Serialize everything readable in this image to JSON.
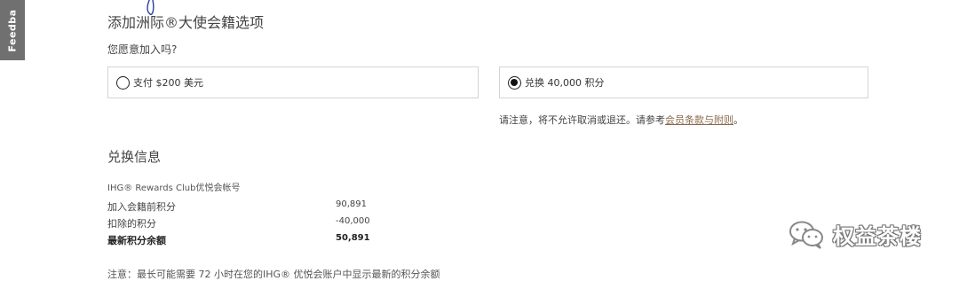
{
  "feedback": {
    "label": "Feedba"
  },
  "section": {
    "title": "添加洲际®大使会籍选项",
    "question": "您愿意加入吗?"
  },
  "options": {
    "pay_label": "支付 $200 美元",
    "redeem_label": "兑换 40,000 积分",
    "selected": "redeem"
  },
  "notice": {
    "text": "请注意，将不允许取消或退还。请参考",
    "link": "会员条款与附则",
    "end": "。"
  },
  "redemption": {
    "title": "兑换信息",
    "account_label": "IHG® Rewards Club优悦会帐号",
    "rows": [
      {
        "label": "加入会籍前积分",
        "value": "90,891"
      },
      {
        "label": "扣除的积分",
        "value": "-40,000"
      },
      {
        "label": "最新积分余额",
        "value": "50,891"
      }
    ]
  },
  "footnote": "注意：最长可能需要 72 小时在您的IHG® 优悦会账户中显示最新的积分余额",
  "watermark": {
    "text": "权益茶楼",
    "icon": "wechat-icon"
  }
}
